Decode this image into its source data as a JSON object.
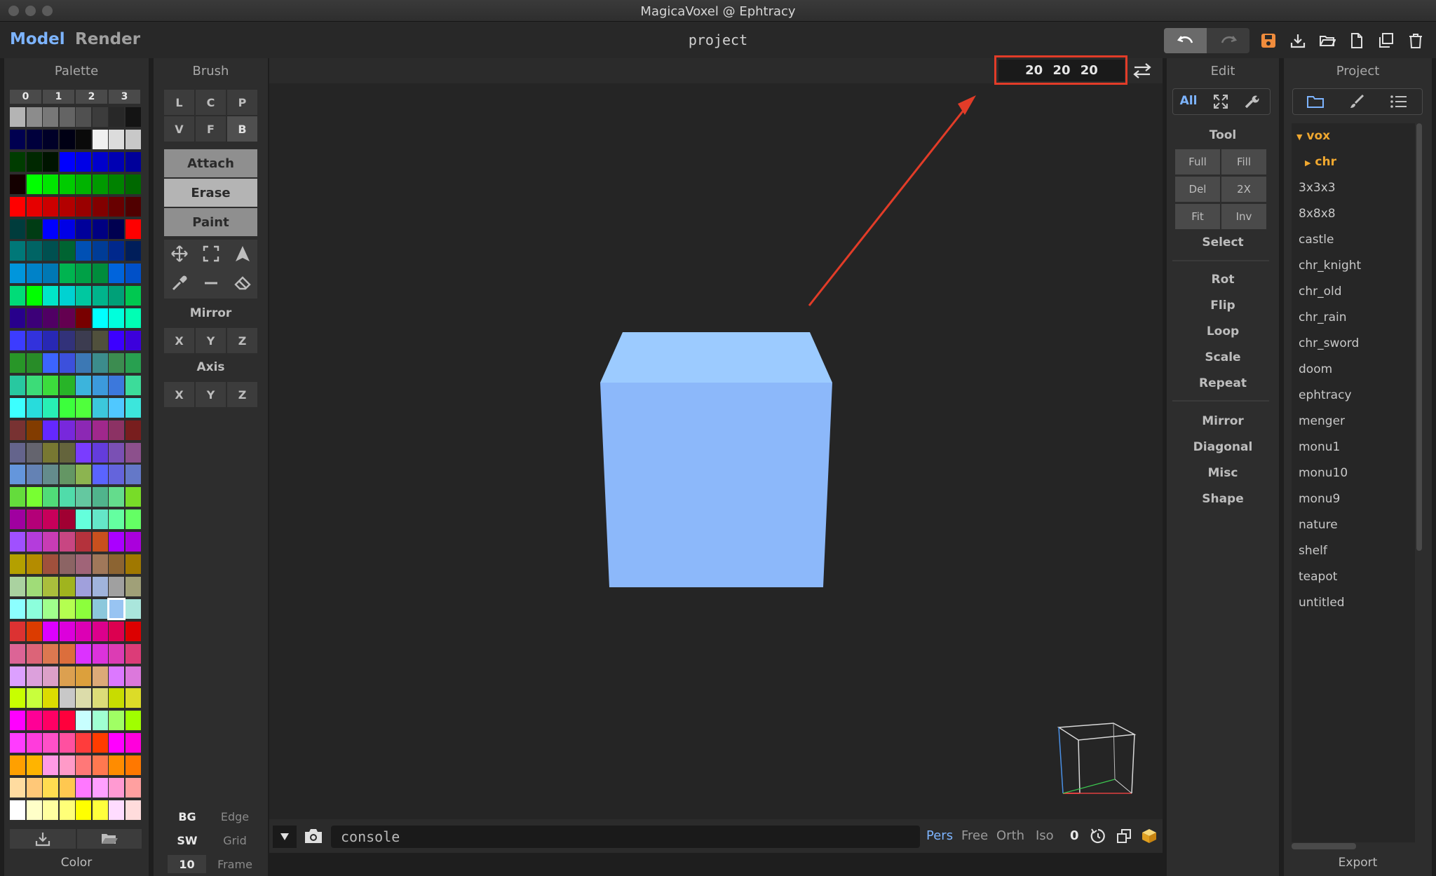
{
  "window": {
    "title": "MagicaVoxel @ Ephtracy"
  },
  "menubar": {
    "modes": [
      {
        "label": "Model",
        "active": true
      },
      {
        "label": "Render",
        "active": false
      }
    ],
    "project_name": "project",
    "file_icons": [
      "save-icon",
      "import-icon",
      "open-folder-icon",
      "new-file-icon",
      "duplicate-icon",
      "delete-icon"
    ]
  },
  "palette": {
    "title": "Palette",
    "tabs": [
      "0",
      "1",
      "2",
      "3"
    ],
    "footer_label": "Color",
    "rows": [
      [
        "#b4b4b4",
        "#8c8c8c",
        "#787878",
        "#646464",
        "#505050",
        "#3c3c3c",
        "#282828",
        "#141414"
      ],
      [
        "#000050",
        "#00003c",
        "#000028",
        "#000014",
        "#0a0a0a",
        "#f0f0f0",
        "#dcdcdc",
        "#c8c8c8"
      ],
      [
        "#003c00",
        "#002800",
        "#001400",
        "#0000ff",
        "#0000e6",
        "#0000cc",
        "#0000b3",
        "#00009a"
      ],
      [
        "#140000",
        "#00ff00",
        "#00e600",
        "#00cc00",
        "#00b300",
        "#009a00",
        "#008200",
        "#006800"
      ],
      [
        "#ff0000",
        "#e60000",
        "#cc0000",
        "#b30000",
        "#9a0000",
        "#820000",
        "#680000",
        "#500000"
      ],
      [
        "#003c3c",
        "#003c14",
        "#0000ff",
        "#0000e6",
        "#00009a",
        "#000082",
        "#000050",
        "#ff0000"
      ],
      [
        "#007878",
        "#006464",
        "#005050",
        "#006432",
        "#0050b4",
        "#003c96",
        "#00288c",
        "#001e5a"
      ],
      [
        "#0096dc",
        "#0082c8",
        "#0078b4",
        "#00b450",
        "#00a046",
        "#008c3c",
        "#0064dc",
        "#0050c8"
      ],
      [
        "#00dc78",
        "#00ff00",
        "#00e6c8",
        "#00d2d2",
        "#00c8a0",
        "#00b48c",
        "#00a078",
        "#00c850"
      ],
      [
        "#28008c",
        "#3c0078",
        "#500064",
        "#640050",
        "#780000",
        "#00ffff",
        "#00ffdc",
        "#00ffb4"
      ],
      [
        "#3c3cff",
        "#3232dc",
        "#2828b4",
        "#32327a",
        "#3c3c50",
        "#50503c",
        "#3c00ff",
        "#3c00dc"
      ],
      [
        "#289628",
        "#288c28",
        "#3c64ff",
        "#3c50dc",
        "#3c78b4",
        "#3c8c8c",
        "#3c8c50",
        "#28a050"
      ],
      [
        "#28c8a0",
        "#3cdc78",
        "#3cdc3c",
        "#28b428",
        "#3cb4dc",
        "#3c9adc",
        "#3c78dc",
        "#3cdc9a"
      ],
      [
        "#3cffff",
        "#28dcdc",
        "#28f0b4",
        "#3cff3c",
        "#50ff3c",
        "#3cc8dc",
        "#50c8ff",
        "#3ce6dc"
      ],
      [
        "#783232",
        "#823c00",
        "#6428ff",
        "#7828dc",
        "#8c28b4",
        "#a0288c",
        "#8c3264",
        "#781e1e"
      ],
      [
        "#64648c",
        "#64646e",
        "#787832",
        "#64643c",
        "#7a3cff",
        "#643cdc",
        "#7a50b4",
        "#8c508c"
      ],
      [
        "#6496dc",
        "#6482b4",
        "#648c8c",
        "#649664",
        "#8cb450",
        "#5a64ff",
        "#6464dc",
        "#6478c8"
      ],
      [
        "#64dc3c",
        "#78ff32",
        "#50dc78",
        "#50dcaa",
        "#64c8a0",
        "#50b48c",
        "#64dc8c",
        "#78dc28"
      ],
      [
        "#a000a0",
        "#b40078",
        "#c8005a",
        "#a00032",
        "#64ffdc",
        "#64e6c8",
        "#64ffa0",
        "#64ff64"
      ],
      [
        "#a050ff",
        "#b43cdc",
        "#c83cb4",
        "#c84682",
        "#b4323c",
        "#c8501e",
        "#aa00ff",
        "#aa00dc"
      ],
      [
        "#b4a000",
        "#b48c00",
        "#a0503c",
        "#8c6464",
        "#a06478",
        "#a0785a",
        "#8c6432",
        "#a07800"
      ],
      [
        "#aad2a0",
        "#a0dc78",
        "#aabe3c",
        "#a0b41e",
        "#a0a0dc",
        "#a0b4dc",
        "#a0a0a0",
        "#a0a078"
      ],
      [
        "#8cffff",
        "#8cffdc",
        "#a0ff8c",
        "#b4ff50",
        "#8cff3c",
        "#8cc8dc",
        "#8cbfff",
        "#aae6dc"
      ],
      [
        "#dc3232",
        "#dc3c00",
        "#dc00ff",
        "#dc00dc",
        "#dc00b4",
        "#dc008c",
        "#dc0050",
        "#dc0000"
      ],
      [
        "#dc6496",
        "#dc6478",
        "#dc7850",
        "#dc6e3c",
        "#dc32ff",
        "#dc32dc",
        "#dc3cb4",
        "#dc3c78"
      ],
      [
        "#dca0ff",
        "#dca0dc",
        "#dca0c8",
        "#dca050",
        "#dca03c",
        "#dcaa78",
        "#dc78ff",
        "#dc78dc"
      ],
      [
        "#c8ff00",
        "#c8ff3c",
        "#dcdc00",
        "#c8c8c8",
        "#dcdcaa",
        "#dcdc78",
        "#c8dc00",
        "#dcdc28"
      ],
      [
        "#ff00ff",
        "#ff0096",
        "#ff0064",
        "#ff003c",
        "#c8ffff",
        "#a0ffd2",
        "#a0ff64",
        "#a0ff00"
      ],
      [
        "#ff3cff",
        "#ff3cdc",
        "#ff50c8",
        "#ff50a0",
        "#ff3c3c",
        "#ff3c00",
        "#ff00ff",
        "#ff00dc"
      ],
      [
        "#ffa000",
        "#ffb400",
        "#ff9ae6",
        "#ff9ac8",
        "#ff7878",
        "#ff7850",
        "#ff8c00",
        "#ff7800"
      ],
      [
        "#ffdca0",
        "#ffc878",
        "#ffdc50",
        "#ffc850",
        "#ff78ff",
        "#ffa0ff",
        "#ff9ad2",
        "#ffa0a0"
      ],
      [
        "#ffffff",
        "#ffffc8",
        "#ffffa0",
        "#ffff78",
        "#ffff00",
        "#ffff3c",
        "#ffdcff",
        "#ffdcdc"
      ]
    ],
    "selected": {
      "row": 22,
      "col": 6,
      "color": "#98c4f2"
    }
  },
  "brush": {
    "title": "Brush",
    "shape_buttons": [
      [
        "L",
        "C",
        "P"
      ],
      [
        "V",
        "F",
        "B"
      ]
    ],
    "active_shape": "B",
    "modes": [
      "Attach",
      "Erase",
      "Paint"
    ],
    "active_mode": "Erase",
    "tool_icons": [
      "move-icon",
      "select-marquee-icon",
      "arrow-up-icon",
      "eyedropper-icon",
      "line-icon",
      "eraser-icon"
    ],
    "mirror_label": "Mirror",
    "mirror_axes": [
      "X",
      "Y",
      "Z"
    ],
    "axis_label": "Axis",
    "axis_axes": [
      "X",
      "Y",
      "Z"
    ],
    "bottom": {
      "bg_label": "BG",
      "edge_label": "Edge",
      "sw_label": "SW",
      "grid_label": "Grid",
      "frame_value": "10",
      "frame_label": "Frame"
    }
  },
  "viewport": {
    "dimensions": "20 20 20",
    "cube_color_top": "#9ccbff",
    "cube_color_front": "#8cb8fa",
    "annotation_color": "#e23c28",
    "console_placeholder": "console",
    "view_modes": [
      "Pers",
      "Free",
      "Orth",
      "Iso"
    ],
    "active_view": "Pers",
    "zoom_value": "0"
  },
  "edit": {
    "title": "Edit",
    "filter_all": "All",
    "tool_label": "Tool",
    "tool_buttons": [
      [
        "Full",
        "Fill"
      ],
      [
        "Del",
        "2X"
      ],
      [
        "Fit",
        "Inv"
      ]
    ],
    "select_label": "Select",
    "group1": [
      "Rot",
      "Flip",
      "Loop",
      "Scale",
      "Repeat"
    ],
    "group2": [
      "Mirror",
      "Diagonal",
      "Misc",
      "Shape"
    ]
  },
  "project": {
    "title": "Project",
    "root": "vox",
    "child": "chr",
    "items": [
      "3x3x3",
      "8x8x8",
      "castle",
      "chr_knight",
      "chr_old",
      "chr_rain",
      "chr_sword",
      "doom",
      "ephtracy",
      "menger",
      "monu1",
      "monu10",
      "monu9",
      "nature",
      "shelf",
      "teapot",
      "untitled"
    ],
    "export_label": "Export",
    "accent": "#f0a830"
  }
}
